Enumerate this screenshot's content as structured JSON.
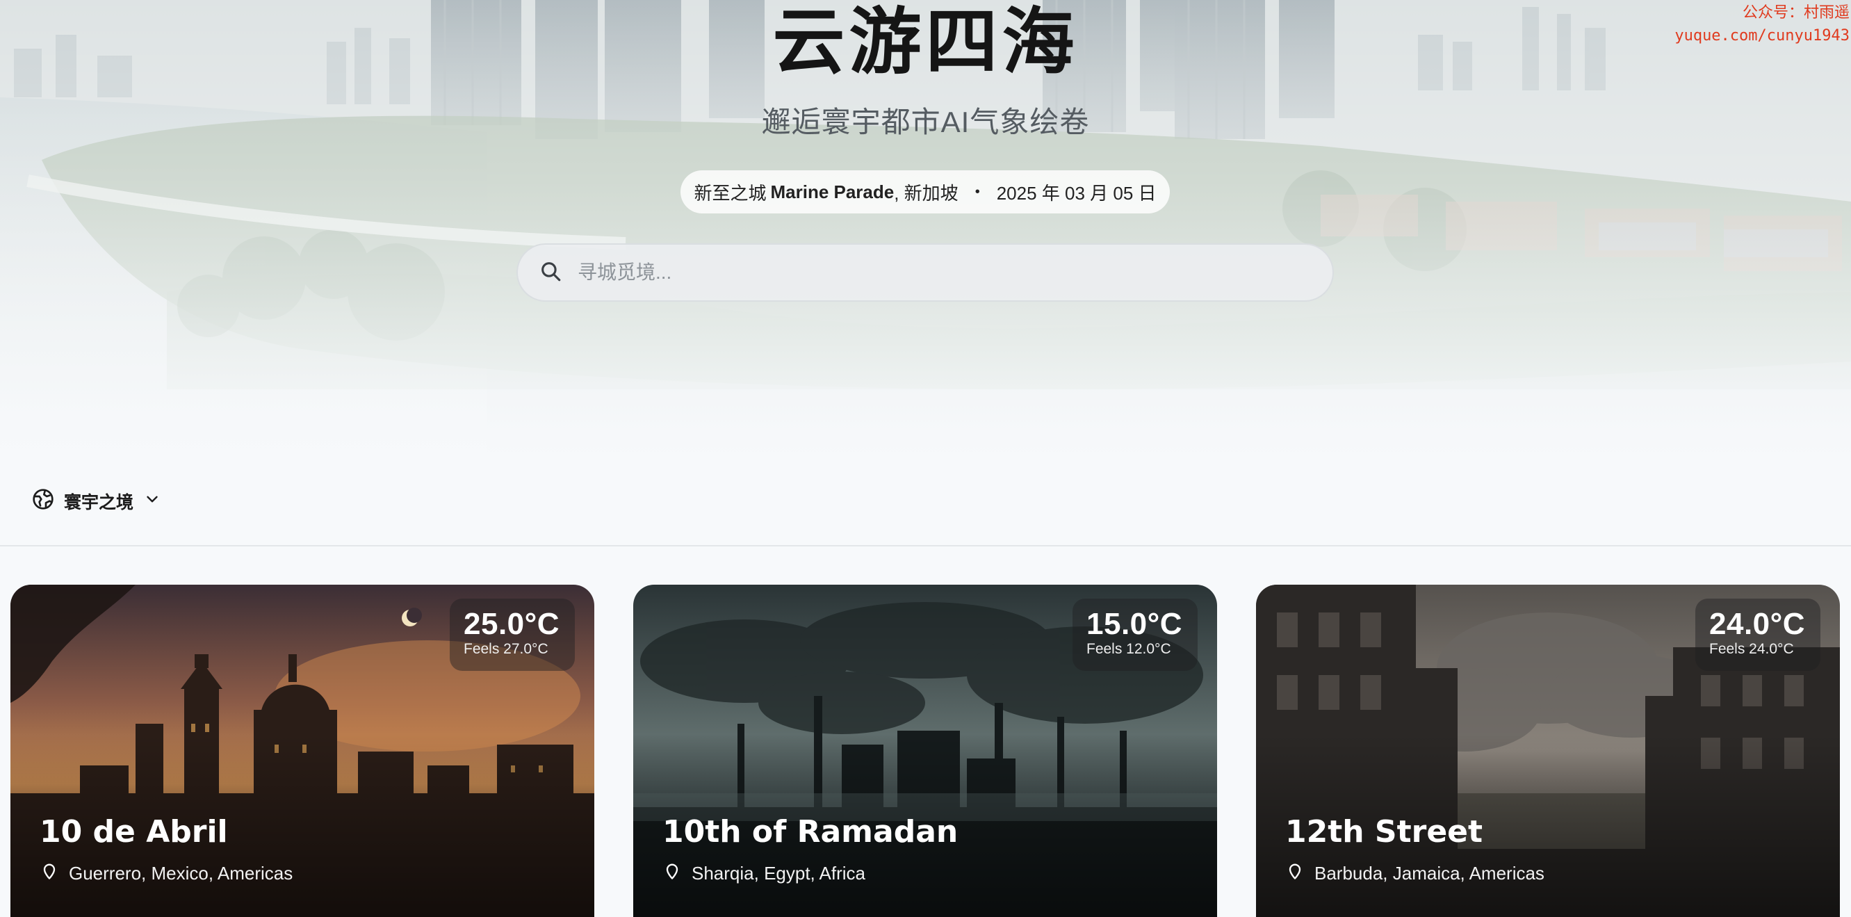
{
  "watermark": {
    "line1": "公众号：村雨遥",
    "line2": "yuque.com/cunyu1943"
  },
  "hero": {
    "title": "云游四海",
    "subtitle": "邂逅寰宇都市AI气象绘卷",
    "location_prefix": "新至之城",
    "location_name": "Marine Parade",
    "location_suffix": ", 新加坡",
    "separator": "•",
    "date": "2025 年 03 月 05 日",
    "search_placeholder": "寻城觅境..."
  },
  "region_filter": {
    "icon": "globe-icon",
    "label": "寰宇之境",
    "chevron": "chevron-down-icon"
  },
  "cards": [
    {
      "name": "10 de Abril",
      "temp": "25.0°C",
      "feels": "Feels 27.0°C",
      "location": "Guerrero, Mexico, Americas",
      "scene": "sunset-cathedral"
    },
    {
      "name": "10th of Ramadan",
      "temp": "15.0°C",
      "feels": "Feels 12.0°C",
      "location": "Sharqia, Egypt, Africa",
      "scene": "smoky-industrial"
    },
    {
      "name": "12th Street",
      "temp": "24.0°C",
      "feels": "Feels 24.0°C",
      "location": "Barbuda, Jamaica, Americas",
      "scene": "cloudy-street"
    }
  ],
  "colors": {
    "watermark": "#e03a1e",
    "page_bg": "#f7f9fb",
    "title": "#151515"
  }
}
